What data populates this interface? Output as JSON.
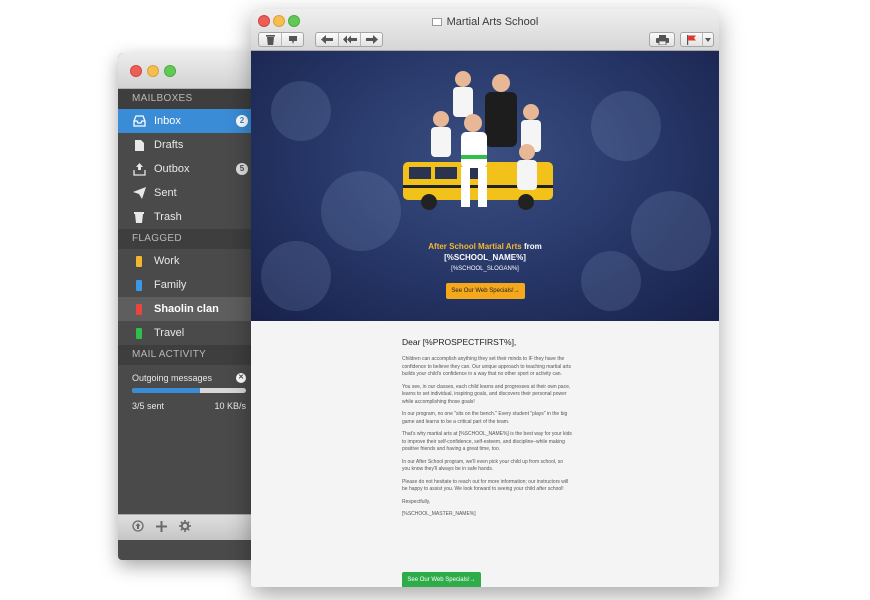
{
  "mail_app": {
    "sections": {
      "mailboxes": "MAILBOXES",
      "flagged": "FLAGGED",
      "activity": "MAIL ACTIVITY"
    },
    "mailboxes": [
      {
        "label": "Inbox",
        "icon": "inbox-icon",
        "badge": "2"
      },
      {
        "label": "Drafts",
        "icon": "document-icon",
        "badge": ""
      },
      {
        "label": "Outbox",
        "icon": "outbox-icon",
        "badge": "5"
      },
      {
        "label": "Sent",
        "icon": "paper-plane-icon",
        "badge": ""
      },
      {
        "label": "Trash",
        "icon": "trash-icon",
        "badge": ""
      }
    ],
    "flagged": [
      {
        "label": "Work",
        "color": "#f5b52c"
      },
      {
        "label": "Family",
        "color": "#3a98e8"
      },
      {
        "label": "Shaolin clan",
        "color": "#e8453c"
      },
      {
        "label": "Travel",
        "color": "#2fbf4a"
      }
    ],
    "activity": {
      "outgoing_label": "Outgoing messages",
      "progress": 0.6,
      "sent_text": "3/5 sent",
      "speed": "10 KB/s"
    },
    "footer_icons": [
      "up-arrow-icon",
      "plus-icon",
      "gear-icon"
    ]
  },
  "message": {
    "window_title": "Martial Arts School",
    "hero": {
      "title_accent": "After School Martial Arts",
      "title_rest": " from",
      "school_name": "[%SCHOOL_NAME%]",
      "slogan": "[%SCHOOL_SLOGAN%]",
      "button": "See Our Web Specials!→"
    },
    "greeting": "Dear [%PROSPECTFIRST%],",
    "paragraphs": [
      "Children can accomplish anything they set their minds to IF they have the confidence to believe they can. Our unique approach to teaching martial arts builds your child's confidence in a way that no other sport or activity can.",
      "You see, in our classes, each child learns and progresses at their own pace, learns to set individual, inspiring goals, and discovers their personal power while accomplishing those goals!",
      "In our program, no one \"sits on the bench.\" Every student \"plays\" in the big game and learns to be a critical part of the team.",
      "That's why martial arts at [%SCHOOL_NAME%] is the best way for your kids to improve their self-confidence, self-esteem, and discipline–while making positive friends and having a great time, too.",
      "In our After School program, we'll even pick your child up from school, so you know they'll always be in safe hands.",
      "Please do not hesitate to reach out for more information; our instructors will be happy to assist you. We look forward to seeing your child after school!",
      "Respectfully,",
      "[%SCHOOL_MASTER_NAME%]"
    ],
    "cta_button": "See Our Web Specials!→"
  },
  "colors": {
    "selection": "#3a8cd6",
    "hero_bg": "#253566",
    "hero_button": "#f5a81c",
    "cta_green": "#2eac4a"
  }
}
